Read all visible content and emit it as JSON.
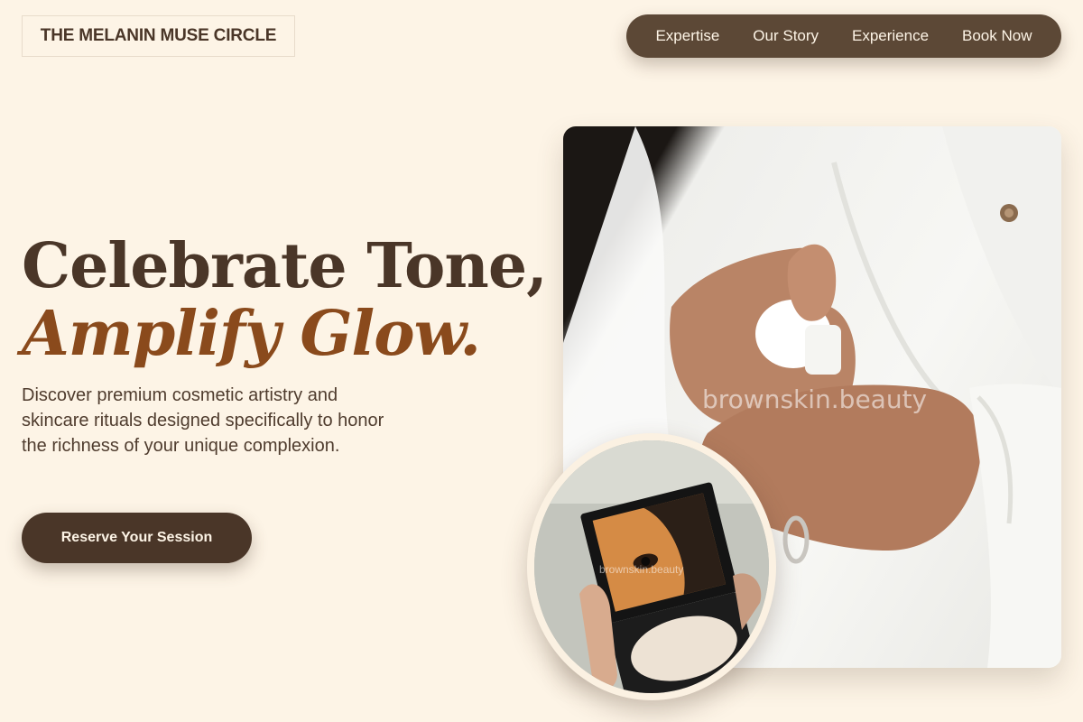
{
  "brand": {
    "name": "THE MELANIN MUSE CIRCLE"
  },
  "nav": {
    "items": [
      {
        "label": "Expertise"
      },
      {
        "label": "Our Story"
      },
      {
        "label": "Experience"
      },
      {
        "label": "Book Now"
      }
    ]
  },
  "hero": {
    "headline_line1": "Celebrate Tone,",
    "headline_line2": "Amplify Glow.",
    "subtext": "Discover premium cosmetic artistry and skincare rituals designed specifically to honor the richness of your unique complexion.",
    "cta_label": "Reserve Your Session"
  },
  "images": {
    "main_watermark": "brownskin.beauty",
    "inset_watermark": "brownskin.beauty"
  },
  "colors": {
    "background": "#fdf4e6",
    "primary_dark": "#4a3628",
    "nav_bg": "#5c4836",
    "accent": "#8a4a1c"
  }
}
